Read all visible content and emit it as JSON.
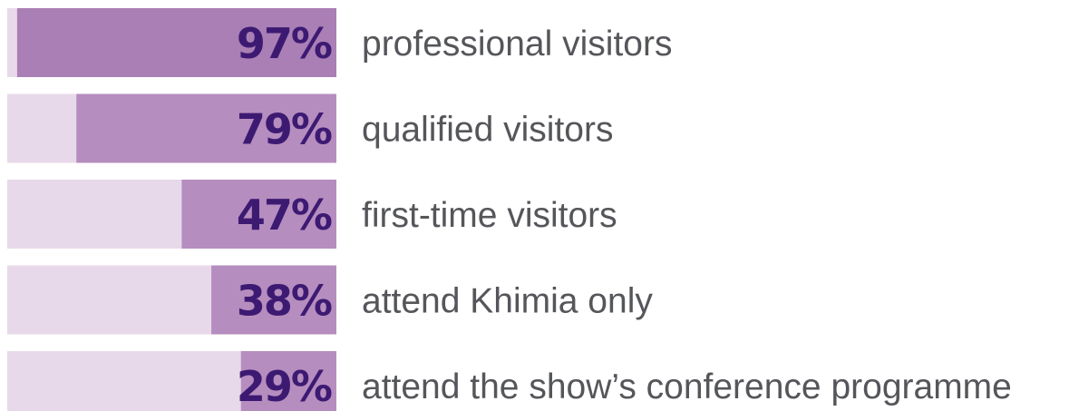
{
  "chart_data": {
    "type": "bar",
    "orientation": "horizontal",
    "categories": [
      "professional visitors",
      "qualified visitors",
      "first-time visitors",
      "attend Khimia only",
      "attend the show’s conference programme"
    ],
    "values": [
      97,
      79,
      47,
      38,
      29
    ],
    "value_labels": [
      "97%",
      "79%",
      "47%",
      "38%",
      "29%"
    ],
    "unit": "%",
    "xlim": [
      0,
      100
    ],
    "title": "",
    "xlabel": "",
    "ylabel": "",
    "grid": false,
    "legend": "none",
    "colors": {
      "track": "#e8d9ea",
      "fill": "#b68dbf",
      "fill_top": "#a97fb5",
      "value_text": "#3d1a72",
      "category_text": "#55565a"
    }
  }
}
